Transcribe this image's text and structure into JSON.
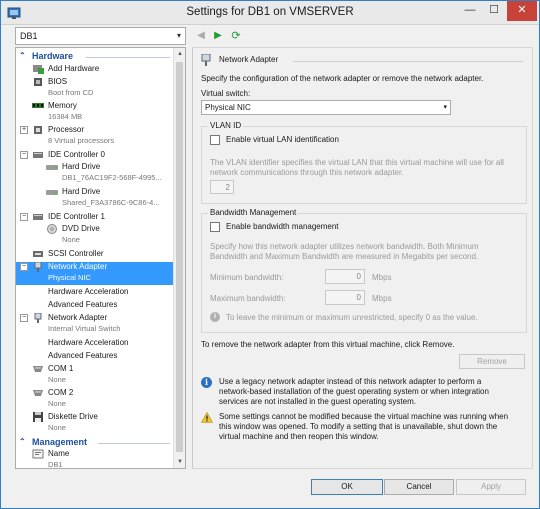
{
  "window": {
    "title": "Settings for DB1 on VMSERVER",
    "minimize": "—",
    "maximize": "☐",
    "close": "✕"
  },
  "toolbar": {
    "vm_selected": "DB1"
  },
  "tree": {
    "hardware_header": "Hardware",
    "management_header": "Management",
    "items": [
      {
        "label": "Add Hardware",
        "sub": ""
      },
      {
        "label": "BIOS",
        "sub": "Boot from CD"
      },
      {
        "label": "Memory",
        "sub": "16384 MB"
      },
      {
        "label": "Processor",
        "sub": "8 Virtual processors"
      },
      {
        "label": "IDE Controller 0",
        "sub": ""
      },
      {
        "label": "Hard Drive",
        "sub": "DB1_76AC19F2-568F-4995..."
      },
      {
        "label": "Hard Drive",
        "sub": "Shared_F3A3786C-9C86-4..."
      },
      {
        "label": "IDE Controller 1",
        "sub": ""
      },
      {
        "label": "DVD Drive",
        "sub": "None"
      },
      {
        "label": "SCSI Controller",
        "sub": ""
      },
      {
        "label": "Network Adapter",
        "sub": "Physical NIC"
      },
      {
        "label": "Hardware Acceleration",
        "sub": ""
      },
      {
        "label": "Advanced Features",
        "sub": ""
      },
      {
        "label": "Network Adapter",
        "sub": "Internal Virtual Switch"
      },
      {
        "label": "Hardware Acceleration",
        "sub": ""
      },
      {
        "label": "Advanced Features",
        "sub": ""
      },
      {
        "label": "COM 1",
        "sub": "None"
      },
      {
        "label": "COM 2",
        "sub": "None"
      },
      {
        "label": "Diskette Drive",
        "sub": "None"
      },
      {
        "label": "Name",
        "sub": "DB1"
      }
    ]
  },
  "panel": {
    "header": "Network Adapter",
    "description": "Specify the configuration of the network adapter or remove the network adapter.",
    "virtual_switch_label": "Virtual switch:",
    "virtual_switch_value": "Physical NIC",
    "vlan_group": "VLAN ID",
    "vlan_checkbox": "Enable virtual LAN identification",
    "vlan_desc_1": "The VLAN identifier specifies the virtual LAN that this virtual machine will use for all",
    "vlan_desc_2": "network communications through this network adapter.",
    "vlan_value": "2",
    "bw_group": "Bandwidth Management",
    "bw_checkbox": "Enable bandwidth management",
    "bw_desc_1": "Specify how this network adapter utilizes network bandwidth. Both Minimum",
    "bw_desc_2": "Bandwidth and Maximum Bandwidth are measured in Megabits per second.",
    "min_bw_label": "Minimum bandwidth:",
    "min_bw_value": "0",
    "min_bw_unit": "Mbps",
    "max_bw_label": "Maximum bandwidth:",
    "max_bw_value": "0",
    "max_bw_unit": "Mbps",
    "bw_hint": "To leave the minimum or maximum unrestricted, specify 0 as the value.",
    "remove_text": "To remove the network adapter from this virtual machine, click Remove.",
    "remove_button": "Remove",
    "info_1": "Use a legacy network adapter instead of this network adapter to perform a",
    "info_2": "network-based installation of the guest operating system or when integration",
    "info_3": "services are not installed in the guest operating system.",
    "warn_1": "Some settings cannot be modified because the virtual machine was running when",
    "warn_2": "this window was opened. To modify a setting that is unavailable, shut down the",
    "warn_3": "virtual machine and then reopen this window."
  },
  "footer": {
    "ok": "OK",
    "cancel": "Cancel",
    "apply": "Apply"
  }
}
